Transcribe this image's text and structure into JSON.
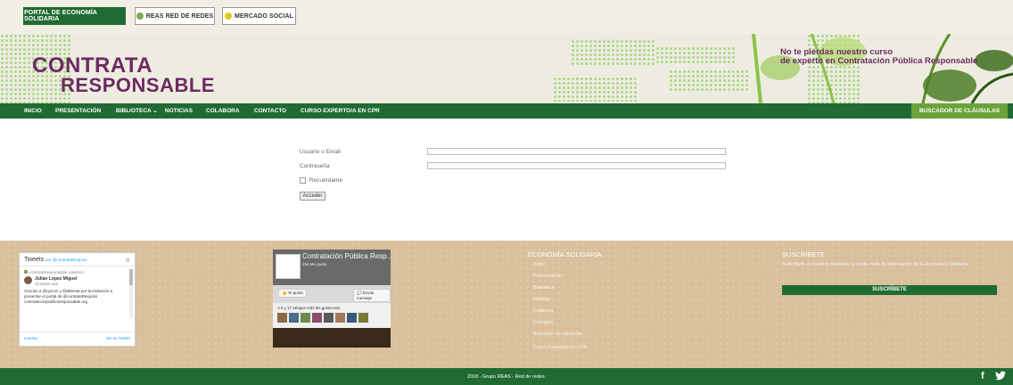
{
  "topbar": {
    "portal": "PORTAL DE ECONOMÍA SOLIDARIA",
    "reas": "REAS RED DE REDES",
    "mercado": "MERCADO SOCIAL"
  },
  "header": {
    "logo_line1": "CONTRATA",
    "logo_line2": "RESPONSABLE",
    "promo_line1": "No te pierdas nuestro curso",
    "promo_line2": "de experto en Contratación Pública Responsable"
  },
  "nav": {
    "items": [
      "INICIO",
      "PRESENTACIÓN",
      "BIBLIOTECA",
      "NOTICIAS",
      "COLABORA",
      "CONTACTO",
      "CURSO EXPERTO/A EN CPR"
    ],
    "biblioteca_chevron": "⌄",
    "right": "BUSCADOR DE CLÁUSULAS"
  },
  "login": {
    "user_label": "Usuario o Email",
    "password_label": "Contraseña",
    "remember_label": "Recuérdame",
    "submit": "Acceder"
  },
  "twitter": {
    "title": "Tweets",
    "by": "por @contrataRespons",
    "retweet": "contrataResponsable retwitteó",
    "author": "Julian Lopez Miguel",
    "handle": "@JulianLoMi",
    "body": "Gracias a @cpcnm y @alternat por la invitación a presentar el portal de @contrataRespons contratacionpublicaresponsable.org",
    "insert": "Insertar",
    "view": "Ver en Twitter"
  },
  "facebook": {
    "page": "Contratación Pública Resp...",
    "likes": "256 Me gusta",
    "like_btn": "Te gusta",
    "send_btn": "Enviar mensaje",
    "friends": "A ti y 17 amigos más les gusta esto"
  },
  "footer": {
    "econ_title": "ECONOMÍA SOLIDARIA",
    "econ_links": [
      "Inicio",
      "Presentación",
      "Biblioteca",
      "Noticias",
      "Colabora",
      "Contacto",
      "Buscador de cláusulas",
      "Curso Experto/a en CPR"
    ],
    "subs_title": "SUSCRÍBETE",
    "subs_text": "Suscríbete a nuestros boletines y recibe toda la información de la Economía Solidaria.",
    "subs_button": "SUSCRÍBETE"
  },
  "bottom": {
    "copyright": "2018 - Grupo REAS - Red de redes.",
    "facebook": "f",
    "twitter": "🐦"
  },
  "colors": {
    "green": "#1f6b32",
    "purple": "#6d2a63",
    "lightgreen": "#6aa33a",
    "sand": "#d9bf9c"
  }
}
